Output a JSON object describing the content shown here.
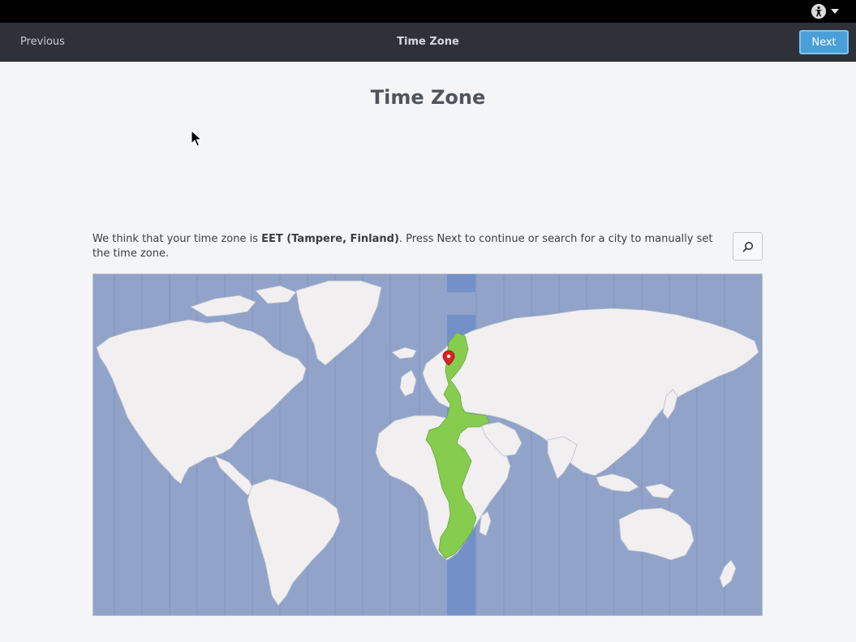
{
  "header": {
    "previous_label": "Previous",
    "title": "Time Zone",
    "next_label": "Next"
  },
  "page": {
    "title": "Time Zone",
    "description_prefix": "We think that your time zone is ",
    "description_timezone": "EET (Tampere, Finland)",
    "description_suffix": ". Press Next to continue or search for a city to manually set the time zone."
  },
  "icons": {
    "accessibility": "accessibility-icon",
    "dropdown": "chevron-down-icon",
    "search": "search-icon",
    "location_pin": "location-pin-icon"
  },
  "colors": {
    "ocean": "#91a3c8",
    "land": "#f1eff0",
    "selected_zone_band": "#7390c9",
    "selected_zone_land": "#86cc4f",
    "pin": "#e0201e",
    "header": "#2e3238",
    "next_button": "#4a9fd8"
  }
}
